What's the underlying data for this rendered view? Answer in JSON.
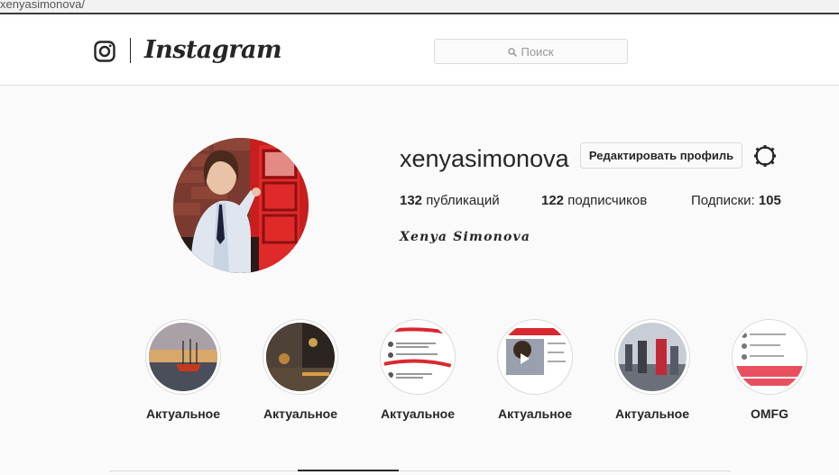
{
  "browser": {
    "url_fragment": "xenyasimonova/"
  },
  "nav": {
    "logo_icon": "instagram-camera-icon",
    "wordmark": "Instagram",
    "search_placeholder": "Поиск",
    "search_icon": "search-icon"
  },
  "profile": {
    "username": "xenyasimonova",
    "edit_label": "Редактировать профиль",
    "settings_icon": "gear-icon",
    "fullname": "Xenya Simonova",
    "stats": {
      "posts_count": "132",
      "posts_label": "публикаций",
      "followers_count": "122",
      "followers_label": "подписчиков",
      "following_label": "Подписки:",
      "following_count": "105"
    }
  },
  "highlights": [
    {
      "label": "Актуальное"
    },
    {
      "label": "Актуальное"
    },
    {
      "label": "Актуальное"
    },
    {
      "label": "Актуальное"
    },
    {
      "label": "Актуальное"
    },
    {
      "label": "OMFG"
    }
  ],
  "colors": {
    "border": "#dbdbdb",
    "text": "#262626",
    "background": "#fafafa",
    "accent_red": "#d8282f"
  }
}
